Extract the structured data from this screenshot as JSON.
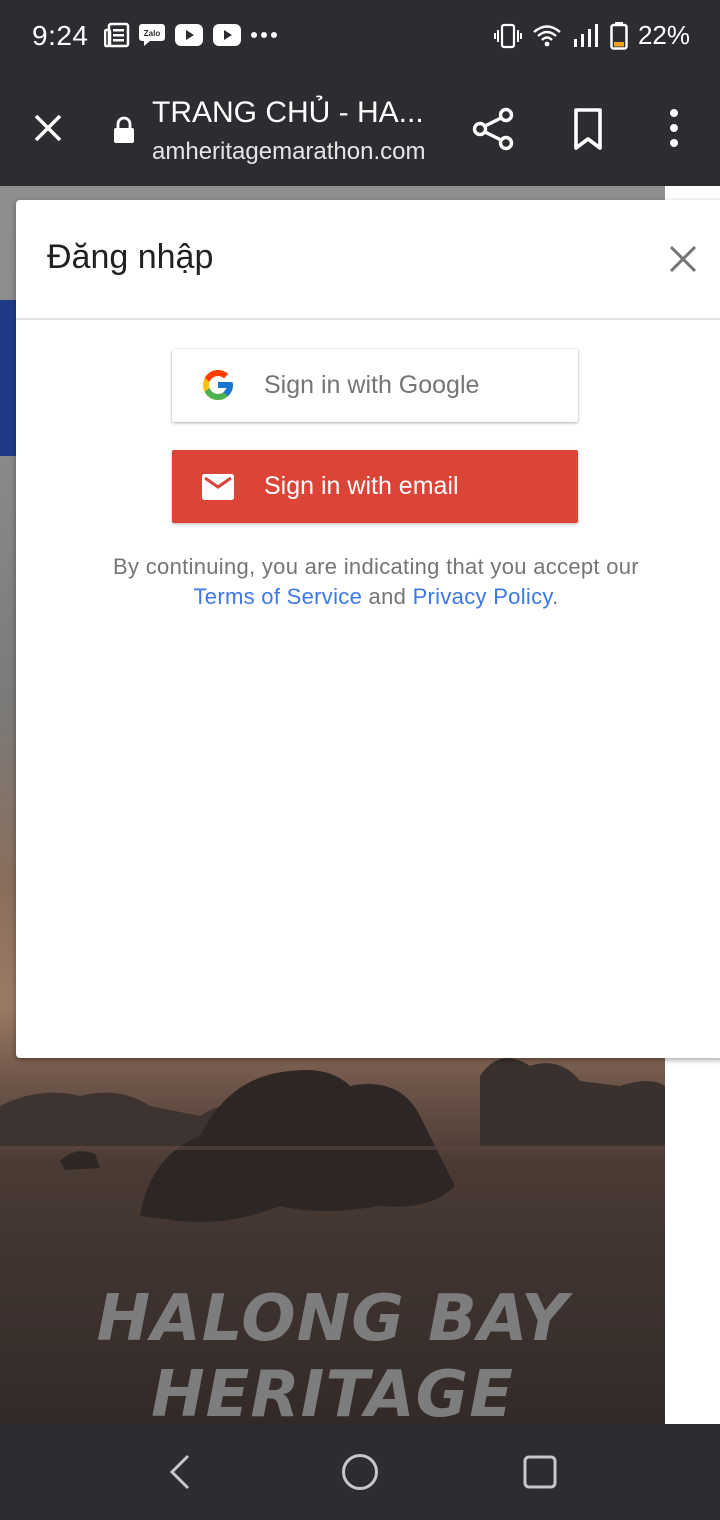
{
  "status_bar": {
    "time": "9:24",
    "notification_icons": [
      "news-icon",
      "zalo-icon",
      "youtube-icon",
      "youtube-icon",
      "more-dots-icon"
    ],
    "system_icons": [
      "vibrate-icon",
      "wifi-icon",
      "signal-icon",
      "battery-low-icon"
    ],
    "battery": "22%",
    "zalo_label": "Zalo"
  },
  "browser": {
    "page_title": "TRANG CHỦ - HA...",
    "url": "amheritagemarathon.com",
    "icons": [
      "close-icon",
      "lock-icon",
      "share-icon",
      "bookmark-icon",
      "more-vert-icon"
    ]
  },
  "hero": {
    "line1": "HALONG BAY",
    "line2": "HERITAGE"
  },
  "dialog": {
    "title": "Đăng nhập",
    "google_button": "Sign in with Google",
    "email_button": "Sign in with email",
    "legal_prefix": "By continuing, you are indicating that you accept our",
    "terms_link": "Terms of Service",
    "legal_and": "and",
    "privacy_link": "Privacy Policy",
    "legal_suffix": "."
  },
  "colors": {
    "system_bar": "#2b2d30",
    "email_button": "#db4437",
    "link": "#3b78e7",
    "text_muted": "#757575"
  },
  "navigation": {
    "icons": [
      "back-icon",
      "home-icon",
      "recents-icon"
    ]
  }
}
